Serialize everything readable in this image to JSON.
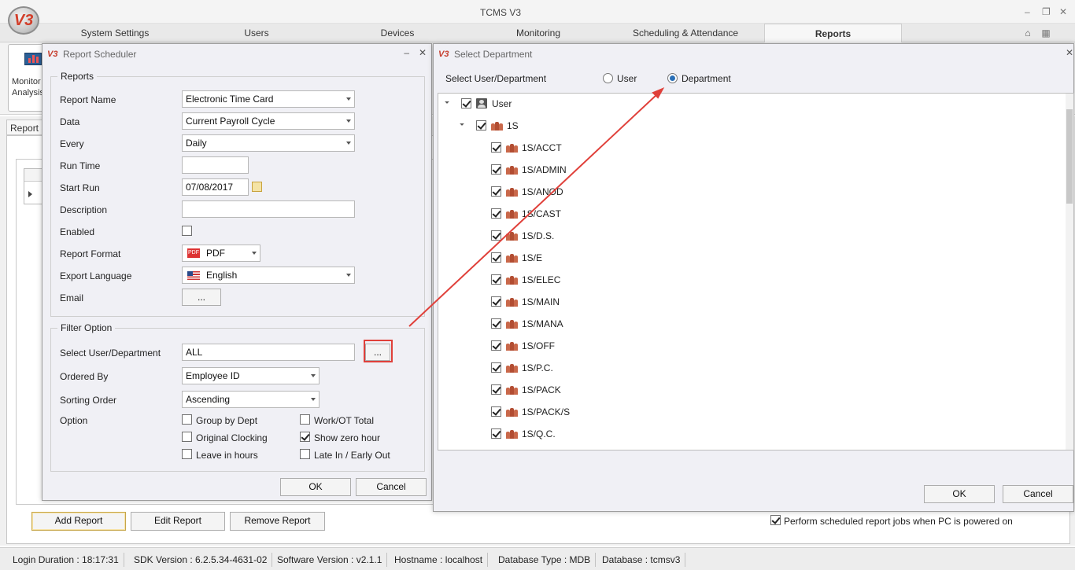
{
  "app": {
    "logo_text": "V3",
    "title": "TCMS V3"
  },
  "ribbon": {
    "tabs": [
      {
        "label": "System Settings"
      },
      {
        "label": "Users"
      },
      {
        "label": "Devices"
      },
      {
        "label": "Monitoring"
      },
      {
        "label": "Scheduling & Attendance"
      },
      {
        "label": "Reports"
      }
    ],
    "active_tab": "Reports",
    "monitor_button_label": "Monitor Analysis"
  },
  "report_tab": {
    "label": "Report S"
  },
  "bottom_buttons": {
    "add": "Add Report",
    "edit": "Edit Report",
    "remove": "Remove Report",
    "perform_label": "Perform scheduled report jobs when PC is powered on",
    "perform_checked": true
  },
  "status": {
    "login": "Login Duration : 18:17:31",
    "sdk": "SDK Version : 6.2.5.34-4631-02",
    "software": "Software Version : v2.1.1",
    "hostname": "Hostname : localhost",
    "dbtype": "Database Type : MDB",
    "database": "Database : tcmsv3"
  },
  "scheduler": {
    "title": "Report Scheduler",
    "reports_group": "Reports",
    "fields": {
      "report_name_label": "Report Name",
      "report_name_value": "Electronic Time Card",
      "data_label": "Data",
      "data_value": "Current Payroll Cycle",
      "every_label": "Every",
      "every_value": "Daily",
      "run_time_label": "Run Time",
      "run_time_value": "",
      "start_run_label": "Start Run",
      "start_run_value": "07/08/2017",
      "description_label": "Description",
      "description_value": "",
      "enabled_label": "Enabled",
      "enabled_checked": false,
      "format_label": "Report Format",
      "format_value": "PDF",
      "language_label": "Export Language",
      "language_value": "English",
      "email_label": "Email",
      "email_button": "..."
    },
    "filter_group": "Filter Option",
    "filter": {
      "select_label": "Select User/Department",
      "select_value": "ALL",
      "select_button": "...",
      "ordered_label": "Ordered By",
      "ordered_value": "Employee ID",
      "sorting_label": "Sorting Order",
      "sorting_value": "Ascending",
      "option_label": "Option",
      "options": [
        {
          "label": "Group by Dept",
          "checked": false
        },
        {
          "label": "Original Clocking",
          "checked": false
        },
        {
          "label": "Leave in hours",
          "checked": false
        },
        {
          "label": "Work/OT Total",
          "checked": false
        },
        {
          "label": "Show zero hour",
          "checked": true
        },
        {
          "label": "Late In / Early Out",
          "checked": false
        }
      ]
    },
    "ok": "OK",
    "cancel": "Cancel"
  },
  "department_dialog": {
    "title": "Select Department",
    "select_label": "Select User/Department",
    "radio_user": "User",
    "radio_department": "Department",
    "selected_radio": "Department",
    "tree": {
      "root": "User",
      "group": "1S",
      "items": [
        "1S/ACCT",
        "1S/ADMIN",
        "1S/ANOD",
        "1S/CAST",
        "1S/D.S.",
        "1S/E",
        "1S/ELEC",
        "1S/MAIN",
        "1S/MANA",
        "1S/OFF",
        "1S/P.C.",
        "1S/PACK",
        "1S/PACK/S",
        "1S/Q.C."
      ]
    },
    "ok": "OK",
    "cancel": "Cancel"
  },
  "colors": {
    "arrow": "#e0403a",
    "highlight_box": "#e0403a"
  }
}
